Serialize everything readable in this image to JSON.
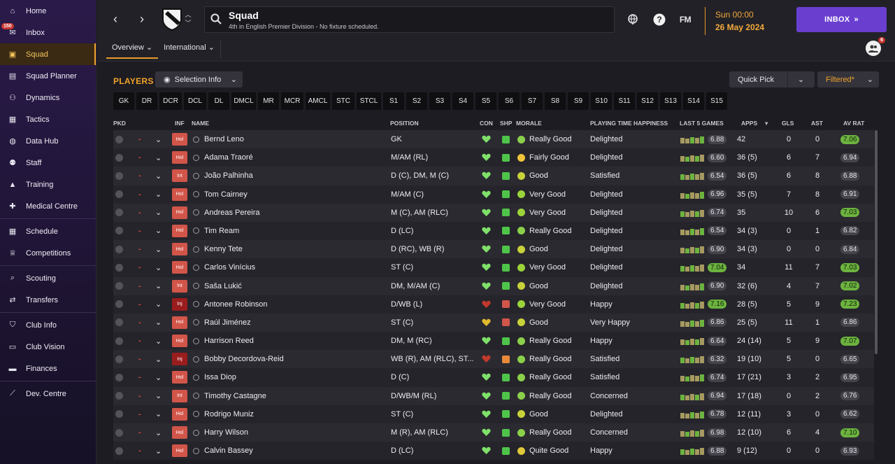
{
  "sidebar": {
    "items": [
      {
        "label": "Home",
        "icon": "home-icon"
      },
      {
        "label": "Inbox",
        "icon": "inbox-icon",
        "badge": "150"
      },
      {
        "label": "Squad",
        "icon": "shirt-icon",
        "active": true
      },
      {
        "label": "Squad Planner",
        "icon": "clipboard-icon"
      },
      {
        "label": "Dynamics",
        "icon": "people-icon"
      },
      {
        "label": "Tactics",
        "icon": "tactics-board-icon"
      },
      {
        "label": "Data Hub",
        "icon": "data-hub-icon"
      },
      {
        "label": "Staff",
        "icon": "staff-icon"
      },
      {
        "label": "Training",
        "icon": "training-cone-icon"
      },
      {
        "label": "Medical Centre",
        "icon": "medical-icon"
      },
      {
        "label": "Schedule",
        "icon": "calendar-icon"
      },
      {
        "label": "Competitions",
        "icon": "trophy-icon"
      },
      {
        "label": "Scouting",
        "icon": "magnifier-icon"
      },
      {
        "label": "Transfers",
        "icon": "transfer-arrows-icon"
      },
      {
        "label": "Club Info",
        "icon": "shield-icon"
      },
      {
        "label": "Club Vision",
        "icon": "briefcase-icon"
      },
      {
        "label": "Finances",
        "icon": "money-icon"
      },
      {
        "label": "Dev. Centre",
        "icon": "growth-icon"
      }
    ]
  },
  "header": {
    "title": "Squad",
    "subtitle": "4th in English Premier Division - No fixture scheduled.",
    "fm_label": "FM",
    "day_time": "Sun 00:00",
    "date": "26 May 2024",
    "inbox_label": "INBOX",
    "tabs": [
      "Overview",
      "International"
    ],
    "people_badge": "6"
  },
  "toolbar": {
    "players_label": "PLAYERS",
    "selection_info": "Selection Info",
    "quick_pick": "Quick Pick",
    "filtered": "Filtered*"
  },
  "positions": [
    "GK",
    "DR",
    "DCR",
    "DCL",
    "DL",
    "DMCL",
    "MR",
    "MCR",
    "AMCL",
    "STC",
    "STCL",
    "S1",
    "S2",
    "S3",
    "S4",
    "S5",
    "S6",
    "S7",
    "S8",
    "S9",
    "S10",
    "S11",
    "S12",
    "S13",
    "S14",
    "S15"
  ],
  "table": {
    "headers": {
      "pkd": "PKD",
      "inf": "INF",
      "name": "NAME",
      "position": "POSITION",
      "con": "CON",
      "shp": "SHP",
      "morale": "MORALE",
      "pth": "PLAYING TIME HAPPINESS",
      "last5": "LAST 5 GAMES",
      "apps": "APPS",
      "gls": "GLS",
      "ast": "AST",
      "avrat": "AV RAT"
    },
    "rows": [
      {
        "inf": "Hol",
        "name": "Bernd Leno",
        "pos": "GK",
        "con": "green",
        "shp": "up",
        "morale": "Really Good",
        "mcol": "#8bd04a",
        "pth": "Delighted",
        "last5": "6.88",
        "apps": "42",
        "gls": "0",
        "ast": "0",
        "avr": "7.06",
        "avrGood": true
      },
      {
        "inf": "Hol",
        "name": "Adama Traoré",
        "pos": "M/AM (RL)",
        "con": "green",
        "shp": "up",
        "morale": "Fairly Good",
        "mcol": "#f0c43a",
        "pth": "Delighted",
        "last5": "6.60",
        "apps": "36 (5)",
        "gls": "6",
        "ast": "7",
        "avr": "6.94",
        "avrGood": false
      },
      {
        "inf": "Int",
        "name": "João Palhinha",
        "pos": "D (C), DM, M (C)",
        "con": "green",
        "shp": "up",
        "morale": "Good",
        "mcol": "#c8d23a",
        "pth": "Satisfied",
        "last5": "6.54",
        "apps": "36 (5)",
        "gls": "6",
        "ast": "8",
        "avr": "6.88",
        "avrGood": false
      },
      {
        "inf": "Hol",
        "name": "Tom Cairney",
        "pos": "M/AM (C)",
        "con": "green",
        "shp": "up",
        "morale": "Very Good",
        "mcol": "#9bd43a",
        "pth": "Delighted",
        "last5": "6.96",
        "apps": "35 (5)",
        "gls": "7",
        "ast": "8",
        "avr": "6.91",
        "avrGood": false
      },
      {
        "inf": "Hol",
        "name": "Andreas Pereira",
        "pos": "M (C), AM (RLC)",
        "con": "green",
        "shp": "up",
        "morale": "Very Good",
        "mcol": "#9bd43a",
        "pth": "Delighted",
        "last5": "6.74",
        "apps": "35",
        "gls": "10",
        "ast": "6",
        "avr": "7.03",
        "avrGood": true
      },
      {
        "inf": "Hol",
        "name": "Tim Ream",
        "pos": "D (LC)",
        "con": "green",
        "shp": "up",
        "morale": "Really Good",
        "mcol": "#8bd04a",
        "pth": "Delighted",
        "last5": "6.54",
        "apps": "34 (3)",
        "gls": "0",
        "ast": "1",
        "avr": "6.82",
        "avrGood": false
      },
      {
        "inf": "Hol",
        "name": "Kenny Tete",
        "pos": "D (RC), WB (R)",
        "con": "green",
        "shp": "flat",
        "morale": "Good",
        "mcol": "#c8d23a",
        "pth": "Delighted",
        "last5": "6.90",
        "apps": "34 (3)",
        "gls": "0",
        "ast": "0",
        "avr": "6.84",
        "avrGood": false
      },
      {
        "inf": "Hol",
        "name": "Carlos Vinícius",
        "pos": "ST (C)",
        "con": "green",
        "shp": "up",
        "morale": "Very Good",
        "mcol": "#9bd43a",
        "pth": "Delighted",
        "last5": "7.04",
        "last5good": true,
        "apps": "34",
        "gls": "11",
        "ast": "7",
        "avr": "7.03",
        "avrGood": true
      },
      {
        "inf": "Int",
        "name": "Saša Lukić",
        "pos": "DM, M/AM (C)",
        "con": "green",
        "shp": "up",
        "morale": "Good",
        "mcol": "#c8d23a",
        "pth": "Delighted",
        "last5": "6.90",
        "apps": "32 (6)",
        "gls": "4",
        "ast": "7",
        "avr": "7.02",
        "avrGood": true
      },
      {
        "inf": "Inj",
        "name": "Antonee Robinson",
        "pos": "D/WB (L)",
        "con": "red",
        "shp": "down",
        "morale": "Very Good",
        "mcol": "#9bd43a",
        "pth": "Happy",
        "last5": "7.16",
        "last5good": true,
        "apps": "28 (5)",
        "gls": "5",
        "ast": "9",
        "avr": "7.23",
        "avrGood": true
      },
      {
        "inf": "Hol",
        "name": "Raúl Jiménez",
        "pos": "ST (C)",
        "con": "yellow",
        "shp": "down",
        "morale": "Good",
        "mcol": "#c8d23a",
        "pth": "Very Happy",
        "last5": "6.86",
        "apps": "25 (5)",
        "gls": "11",
        "ast": "1",
        "avr": "6.86",
        "avrGood": false
      },
      {
        "inf": "Hol",
        "name": "Harrison Reed",
        "pos": "DM, M (RC)",
        "con": "green",
        "shp": "flat",
        "morale": "Really Good",
        "mcol": "#8bd04a",
        "pth": "Happy",
        "last5": "6.64",
        "apps": "24 (14)",
        "gls": "5",
        "ast": "9",
        "avr": "7.07",
        "avrGood": true
      },
      {
        "inf": "Inj",
        "name": "Bobby Decordova-Reid",
        "pos": "WB (R), AM (RLC), ST...",
        "con": "red",
        "shp": "orange",
        "morale": "Really Good",
        "mcol": "#8bd04a",
        "pth": "Satisfied",
        "last5": "6.32",
        "apps": "19 (10)",
        "gls": "5",
        "ast": "0",
        "avr": "6.65",
        "avrGood": false
      },
      {
        "inf": "Hol",
        "name": "Issa Diop",
        "pos": "D (C)",
        "con": "green",
        "shp": "flat",
        "morale": "Really Good",
        "mcol": "#8bd04a",
        "pth": "Satisfied",
        "last5": "6.74",
        "apps": "17 (21)",
        "gls": "3",
        "ast": "2",
        "avr": "6.95",
        "avrGood": false
      },
      {
        "inf": "Int",
        "name": "Timothy Castagne",
        "pos": "D/WB/M (RL)",
        "con": "green",
        "shp": "flat",
        "morale": "Really Good",
        "mcol": "#8bd04a",
        "pth": "Concerned",
        "last5": "6.94",
        "apps": "17 (18)",
        "gls": "0",
        "ast": "2",
        "avr": "6.76",
        "avrGood": false
      },
      {
        "inf": "Hol",
        "name": "Rodrigo Muniz",
        "pos": "ST (C)",
        "con": "green",
        "shp": "flat",
        "morale": "Good",
        "mcol": "#c8d23a",
        "pth": "Delighted",
        "last5": "6.78",
        "apps": "12 (11)",
        "gls": "3",
        "ast": "0",
        "avr": "6.62",
        "avrGood": false
      },
      {
        "inf": "Hol",
        "name": "Harry Wilson",
        "pos": "M (R), AM (RLC)",
        "con": "green",
        "shp": "flat",
        "morale": "Really Good",
        "mcol": "#8bd04a",
        "pth": "Concerned",
        "last5": "6.98",
        "apps": "12 (10)",
        "gls": "6",
        "ast": "4",
        "avr": "7.10",
        "avrGood": true
      },
      {
        "inf": "Hol",
        "name": "Calvin Bassey",
        "pos": "D (LC)",
        "con": "green",
        "shp": "flat",
        "morale": "Quite Good",
        "mcol": "#e0c83a",
        "pth": "Happy",
        "last5": "6.88",
        "apps": "9 (12)",
        "gls": "0",
        "ast": "0",
        "avr": "6.93",
        "avrGood": false
      }
    ]
  },
  "colors": {
    "accent": "#f0a32a",
    "brand": "#6a3fd0",
    "good": "#6cb33f",
    "injury": "#9a1d1d",
    "status": "#d2554a"
  }
}
